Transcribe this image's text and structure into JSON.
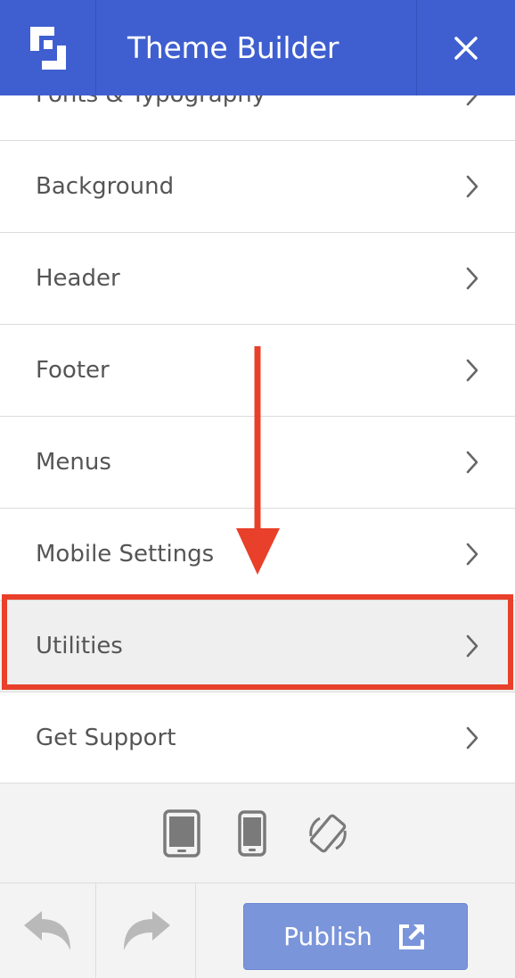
{
  "header": {
    "title": "Theme Builder",
    "logo_icon": "theme-builder-logo-icon",
    "close_icon": "close-icon",
    "background_color": "#3f5fd0"
  },
  "menu": {
    "items": [
      {
        "label": "Fonts & Typography",
        "icon": "chevron-right-icon"
      },
      {
        "label": "Background",
        "icon": "chevron-right-icon"
      },
      {
        "label": "Header",
        "icon": "chevron-right-icon"
      },
      {
        "label": "Footer",
        "icon": "chevron-right-icon"
      },
      {
        "label": "Menus",
        "icon": "chevron-right-icon"
      },
      {
        "label": "Mobile Settings",
        "icon": "chevron-right-icon"
      },
      {
        "label": "Utilities",
        "icon": "chevron-right-icon",
        "highlighted": true
      },
      {
        "label": "Get Support",
        "icon": "chevron-right-icon"
      }
    ],
    "annotation_color": "#e8402a"
  },
  "device_bar": {
    "icons": [
      "tablet-icon",
      "phone-icon",
      "rotate-icon"
    ]
  },
  "toolbar": {
    "undo_icon": "undo-icon",
    "redo_icon": "redo-icon",
    "publish_label": "Publish",
    "publish_icon": "external-link-icon",
    "publish_color": "#7b95db"
  }
}
